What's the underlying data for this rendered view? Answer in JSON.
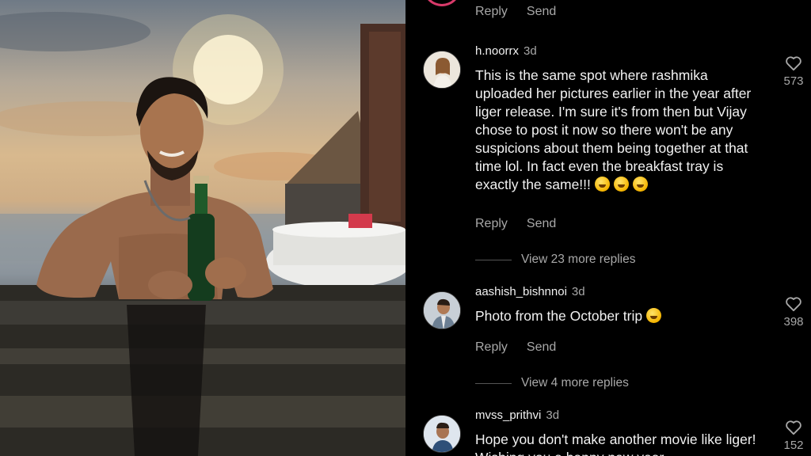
{
  "photo": {
    "icon": "photo-of-man-in-infinity-pool-holding-bottle"
  },
  "top_actions": {
    "reply": "Reply",
    "send": "Send"
  },
  "comments": [
    {
      "username": "h.noorrx",
      "age": "3d",
      "text": "This is the same spot where rashmika uploaded her pictures earlier in the year after liger release. I'm sure it's from then but Vijay chose to post it now so there won't be any suspicions about them being together at that time lol. In fact even the breakfast tray is exactly the same!!!",
      "likes": "573",
      "reply": "Reply",
      "send": "Send",
      "view_more": "View 23 more replies"
    },
    {
      "username": "aashish_bishnnoi",
      "age": "3d",
      "text": "Photo from the October trip",
      "likes": "398",
      "reply": "Reply",
      "send": "Send",
      "view_more": "View 4 more replies"
    },
    {
      "username": "mvss_prithvi",
      "age": "3d",
      "text": "Hope you don't make another movie like liger! Wishing you a happy new year",
      "likes": "152"
    }
  ],
  "colors": {
    "background": "#000000",
    "muted_text": "#a8a8a8",
    "primary_text": "#f2f2f2"
  }
}
